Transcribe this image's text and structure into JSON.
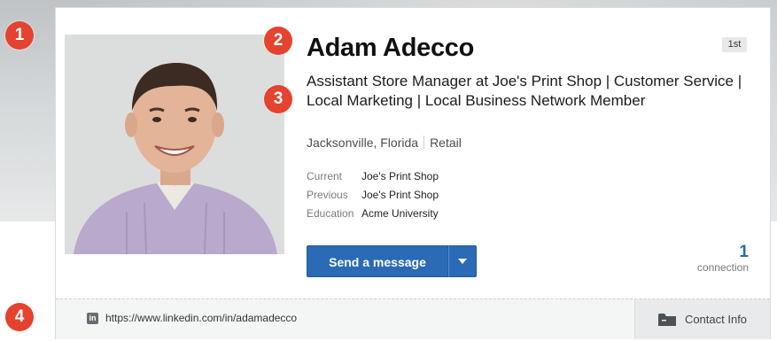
{
  "markers": [
    "1",
    "2",
    "3",
    "4"
  ],
  "profile": {
    "name": "Adam Adecco",
    "degree": "1st",
    "headline": "Assistant Store Manager at Joe's Print Shop | Customer Service | Local Marketing | Local Business Network Member",
    "location": "Jacksonville, Florida",
    "industry": "Retail",
    "facts": [
      {
        "label": "Current",
        "value": "Joe's Print Shop"
      },
      {
        "label": "Previous",
        "value": "Joe's Print Shop"
      },
      {
        "label": "Education",
        "value": "Acme University"
      }
    ]
  },
  "actions": {
    "send_message": "Send a message"
  },
  "connections": {
    "count": "1",
    "label": "connection"
  },
  "footer": {
    "linkedin_badge": "in",
    "url": "https://www.linkedin.com/in/adamadecco",
    "contact_info": "Contact Info"
  },
  "colors": {
    "accent": "#2b6ab5",
    "marker": "#e4432f"
  },
  "icons": {
    "linkedin": "linkedin-icon",
    "dropdown": "caret-down-icon",
    "contact": "folder-icon"
  }
}
